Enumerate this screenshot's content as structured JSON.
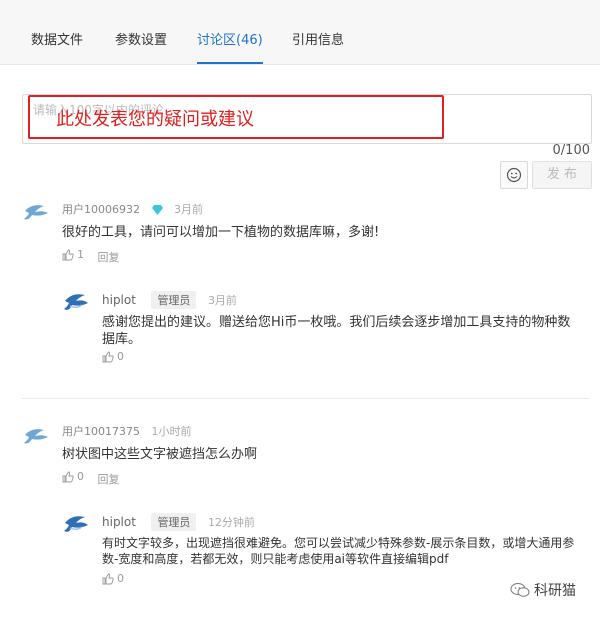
{
  "tabs": [
    {
      "label": "数据文件"
    },
    {
      "label": "参数设置"
    },
    {
      "label": "讨论区(46)"
    },
    {
      "label": "引用信息"
    }
  ],
  "comment_input": {
    "placeholder": "请输入100字以内的评论",
    "counter": "0/100",
    "post_label": "发 布"
  },
  "annotation": {
    "text": "此处发表您的疑问或建议"
  },
  "comments": [
    {
      "user": "用户10006932",
      "time": "3月前",
      "text": "很好的工具，请问可以增加一下植物的数据库嘛，多谢!",
      "likes": "1",
      "reply_label": "回复",
      "reply": {
        "user": "hiplot",
        "badge": "管理员",
        "time": "3月前",
        "text": "感谢您提出的建议。赠送给您Hi币一枚哦。我们后续会逐步增加工具支持的物种数据库。",
        "likes": "0"
      }
    },
    {
      "user": "用户10017375",
      "time": "1小时前",
      "text": "树状图中这些文字被遮挡怎么办啊",
      "likes": "0",
      "reply_label": "回复",
      "reply": {
        "user": "hiplot",
        "badge": "管理员",
        "time": "12分钟前",
        "text": "有时文字较多，出现遮挡很难避免。您可以尝试减少特殊参数-展示条目数，或增大通用参数-宽度和高度，若都无效，则只能考虑使用ai等软件直接编辑pdf",
        "likes": "0"
      }
    }
  ],
  "watermark": {
    "text": "科研猫"
  },
  "colors": {
    "accent": "#1f73c8",
    "annotation": "#e02020"
  }
}
